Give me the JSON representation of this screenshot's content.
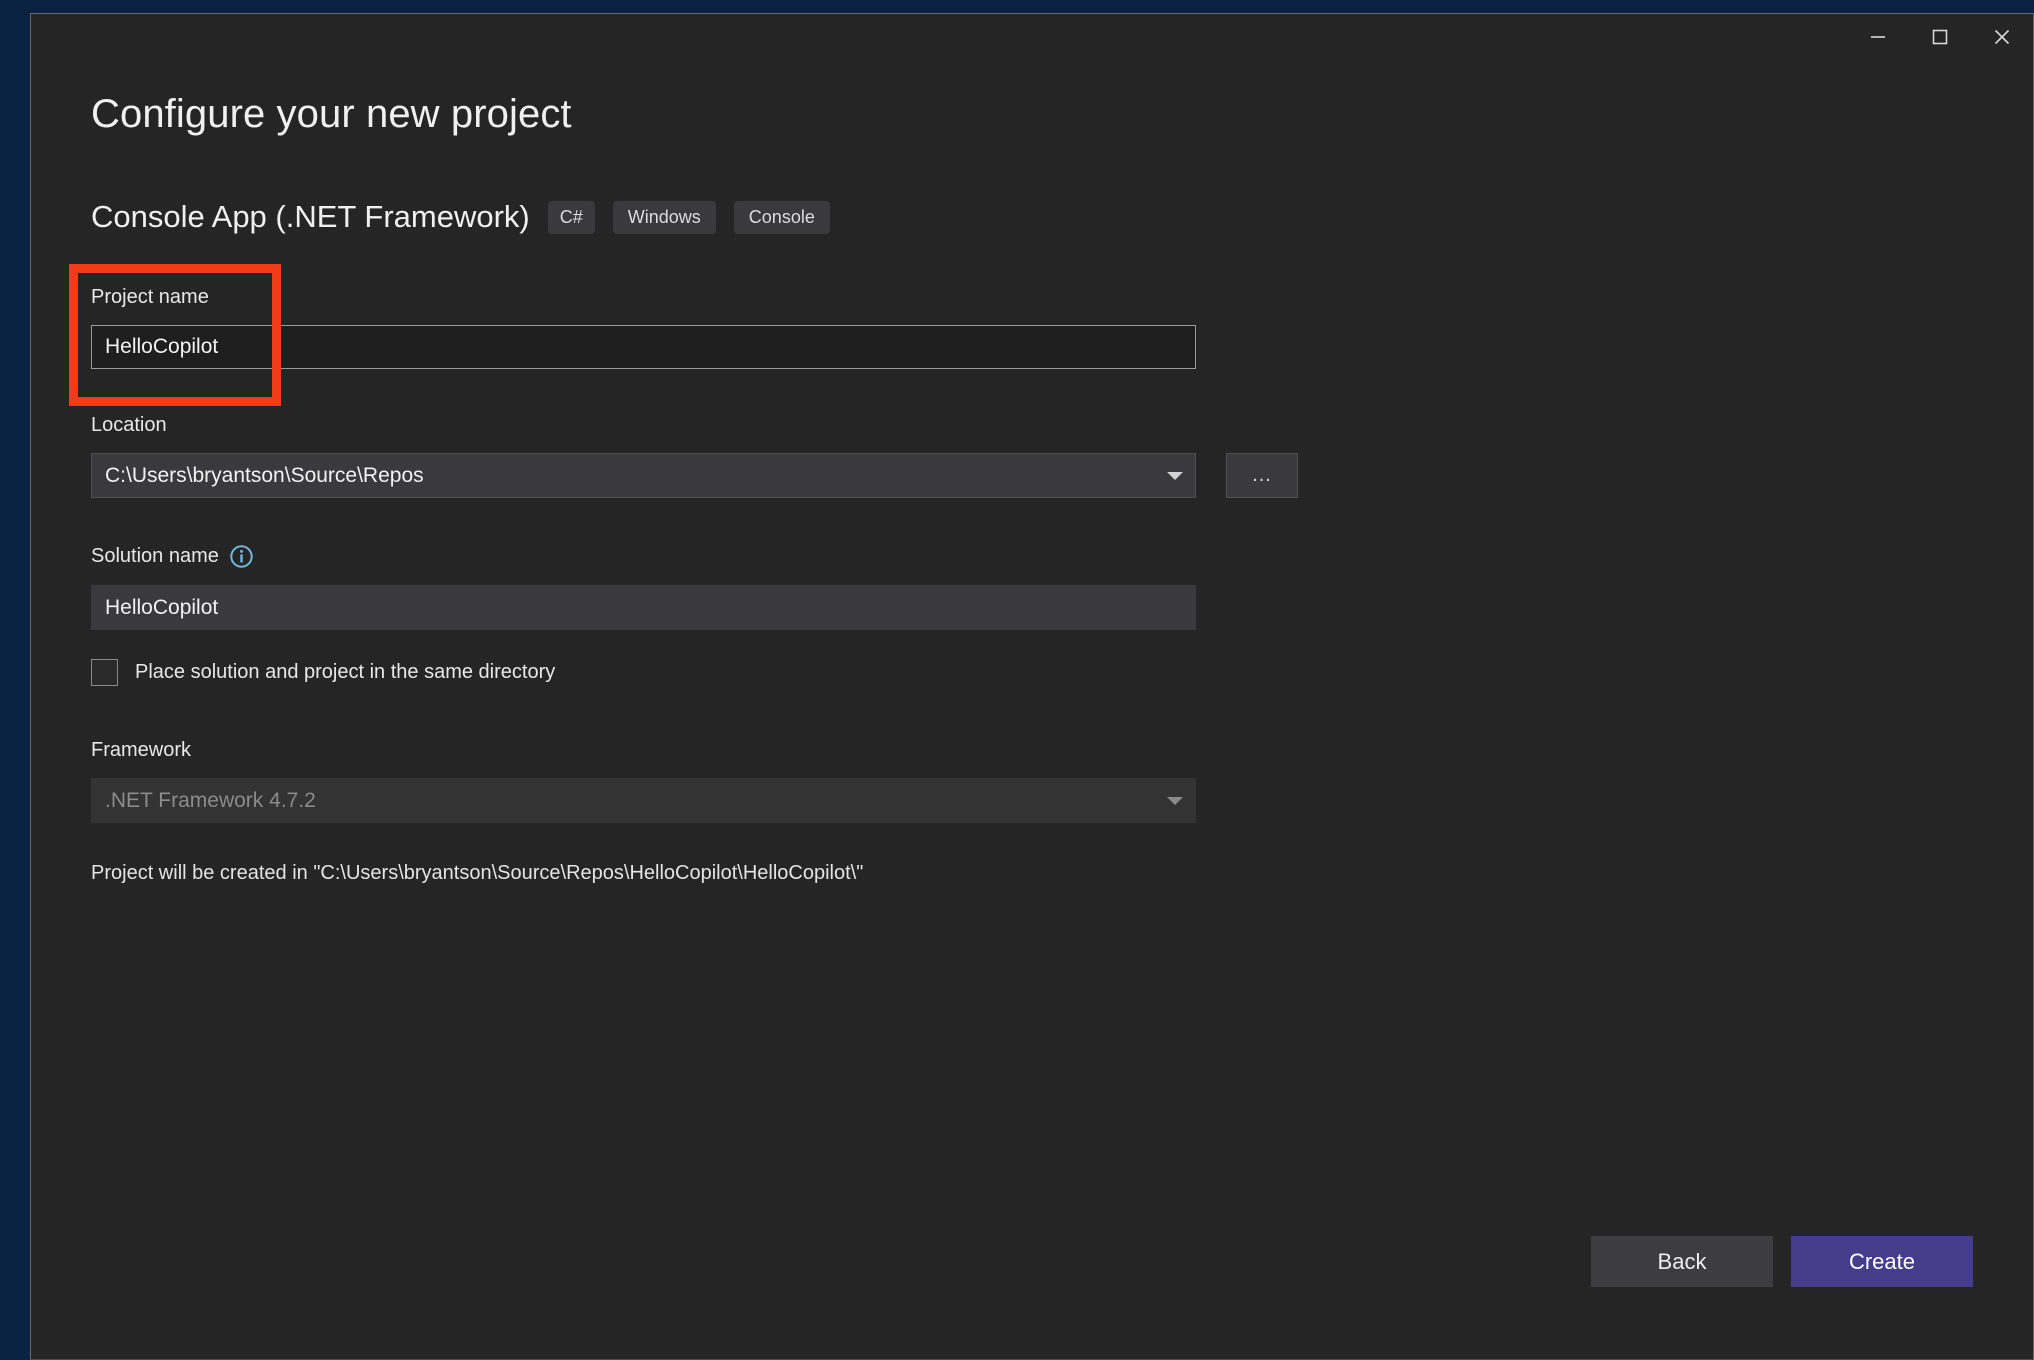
{
  "window": {
    "controls": [
      {
        "name": "minimize",
        "icon": "minimize-icon",
        "label": "Minimize"
      },
      {
        "name": "maximize",
        "icon": "maximize-icon",
        "label": "Maximize"
      },
      {
        "name": "close",
        "icon": "close-icon",
        "label": "Close"
      }
    ]
  },
  "header": {
    "title": "Configure your new project",
    "template_name": "Console App (.NET Framework)",
    "tags": [
      "C#",
      "Windows",
      "Console"
    ]
  },
  "fields": {
    "project_name": {
      "label": "Project name",
      "value": "HelloCopilot",
      "placeholder": ""
    },
    "location": {
      "label": "Location",
      "value": "C:\\Users\\bryantson\\Source\\Repos",
      "browse_label": "...",
      "dropdown_icon": "chevron-down-icon"
    },
    "solution_name": {
      "label": "Solution name",
      "info_icon": "info-circle-icon",
      "value": "HelloCopilot",
      "placeholder": ""
    },
    "same_directory": {
      "label": "Place solution and project in the same directory",
      "checked": false
    },
    "framework": {
      "label": "Framework",
      "value": ".NET Framework 4.7.2",
      "disabled": true,
      "dropdown_icon": "chevron-down-icon"
    }
  },
  "note": {
    "text": "Project will be created in \"C:\\Users\\bryantson\\Source\\Repos\\HelloCopilot\\HelloCopilot\\\""
  },
  "footer": {
    "back_label": "Back",
    "create_label": "Create"
  },
  "annotation": {
    "color": "#f23c17",
    "target": "project-name-field"
  },
  "colors": {
    "dialog_background": "#252526",
    "accent_primary": "#453d8c",
    "info_icon": "#6fb7e0",
    "annotation": "#f23c17",
    "desktop": "#0b2342"
  }
}
